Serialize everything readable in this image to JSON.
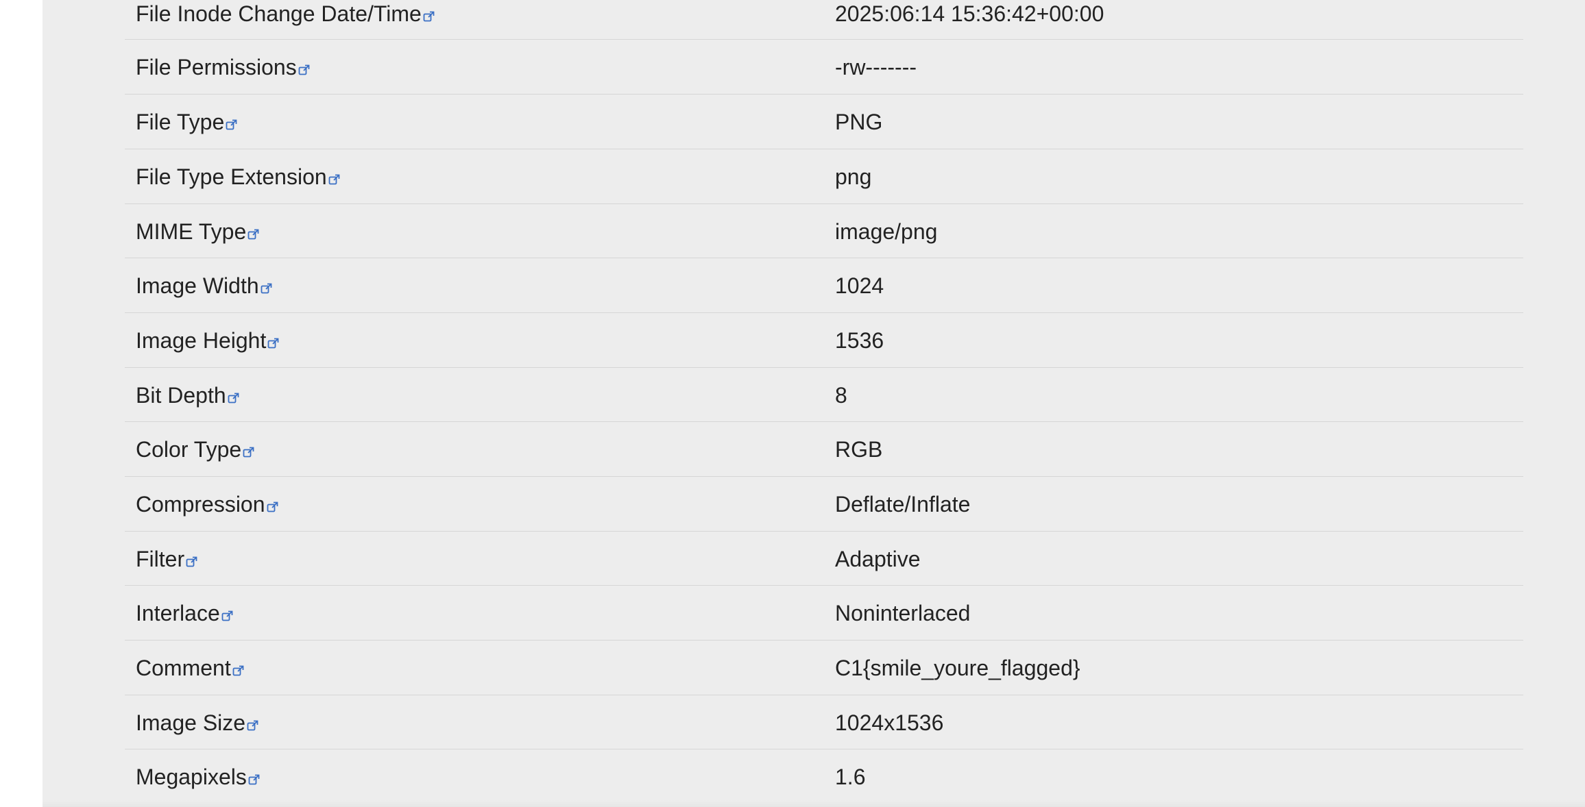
{
  "rows": [
    {
      "tag": "File Inode Change Date/Time",
      "value": "2025:06:14 15:36:42+00:00"
    },
    {
      "tag": "File Permissions",
      "value": "-rw-------"
    },
    {
      "tag": "File Type",
      "value": "PNG"
    },
    {
      "tag": "File Type Extension",
      "value": "png"
    },
    {
      "tag": "MIME Type",
      "value": "image/png"
    },
    {
      "tag": "Image Width",
      "value": "1024"
    },
    {
      "tag": "Image Height",
      "value": "1536"
    },
    {
      "tag": "Bit Depth",
      "value": "8"
    },
    {
      "tag": "Color Type",
      "value": "RGB"
    },
    {
      "tag": "Compression",
      "value": "Deflate/Inflate"
    },
    {
      "tag": "Filter",
      "value": "Adaptive"
    },
    {
      "tag": "Interlace",
      "value": "Noninterlaced"
    },
    {
      "tag": "Comment",
      "value": "C1{smile_youre_flagged}"
    },
    {
      "tag": "Image Size",
      "value": "1024x1536"
    },
    {
      "tag": "Megapixels",
      "value": "1.6"
    }
  ],
  "icons": {
    "tag_link": "external-link-icon"
  },
  "colors": {
    "panel_background": "#ededed",
    "row_divider": "#d6d6d6",
    "text": "#222222",
    "link_icon": "#3a6fc4"
  }
}
